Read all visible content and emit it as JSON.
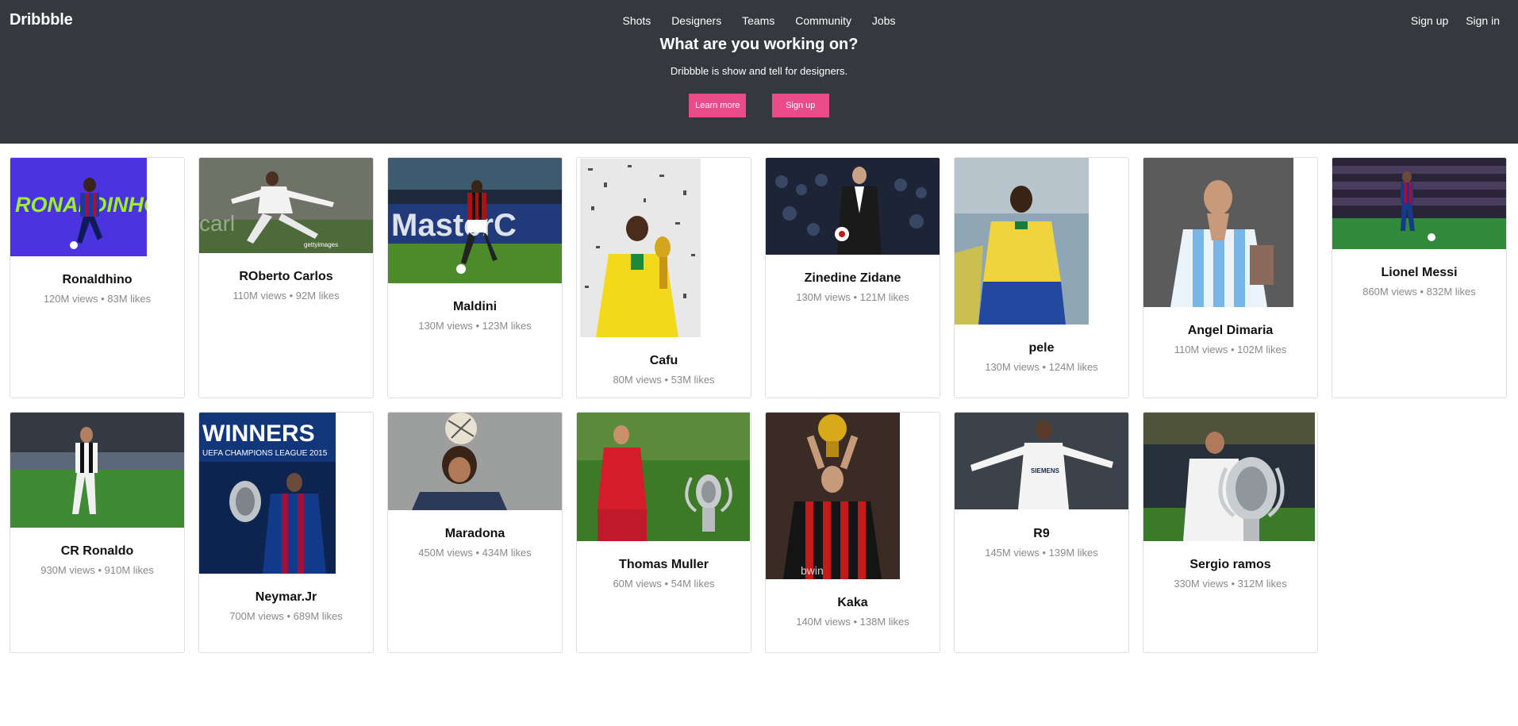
{
  "header": {
    "logo": "Dribbble",
    "nav": [
      "Shots",
      "Designers",
      "Teams",
      "Community",
      "Jobs"
    ],
    "auth": [
      "Sign up",
      "Sign in"
    ],
    "title": "What are you working on?",
    "subtitle": "Dribbble is show and tell for designers.",
    "learn_more": "Learn more",
    "sign_up": "Sign up"
  },
  "colors": {
    "header_bg": "#35383d",
    "accent": "#ea4c89"
  },
  "shots": [
    {
      "name": "Ronaldhino",
      "stats": "120M views • 83M likes"
    },
    {
      "name": "ROberto Carlos",
      "stats": "110M views • 92M likes"
    },
    {
      "name": "Maldini",
      "stats": "130M views • 123M likes"
    },
    {
      "name": "Cafu",
      "stats": "80M views • 53M likes"
    },
    {
      "name": "Zinedine Zidane",
      "stats": "130M views • 121M likes"
    },
    {
      "name": "pele",
      "stats": "130M views • 124M likes"
    },
    {
      "name": "Angel Dimaria",
      "stats": "110M views • 102M likes"
    },
    {
      "name": "Lionel Messi",
      "stats": "860M views • 832M likes"
    },
    {
      "name": "CR Ronaldo",
      "stats": "930M views • 910M likes"
    },
    {
      "name": "Neymar.Jr",
      "stats": "700M views • 689M likes"
    },
    {
      "name": "Maradona",
      "stats": "450M views • 434M likes"
    },
    {
      "name": "Thomas Muller",
      "stats": "60M views • 54M likes"
    },
    {
      "name": "Kaka",
      "stats": "140M views • 138M likes"
    },
    {
      "name": "R9",
      "stats": "145M views • 139M likes"
    },
    {
      "name": "Sergio ramos",
      "stats": "330M views • 312M likes"
    }
  ],
  "image_text": {
    "ronaldinho": "RONALDINHO",
    "carlos": "gettyimages",
    "maldini": "MasterC",
    "neymar_1": "WINNERS",
    "neymar_2": "UEFA CHAMPIONS LEAGUE 2015",
    "r9": "SIEMENS",
    "kaka": "bwin"
  }
}
